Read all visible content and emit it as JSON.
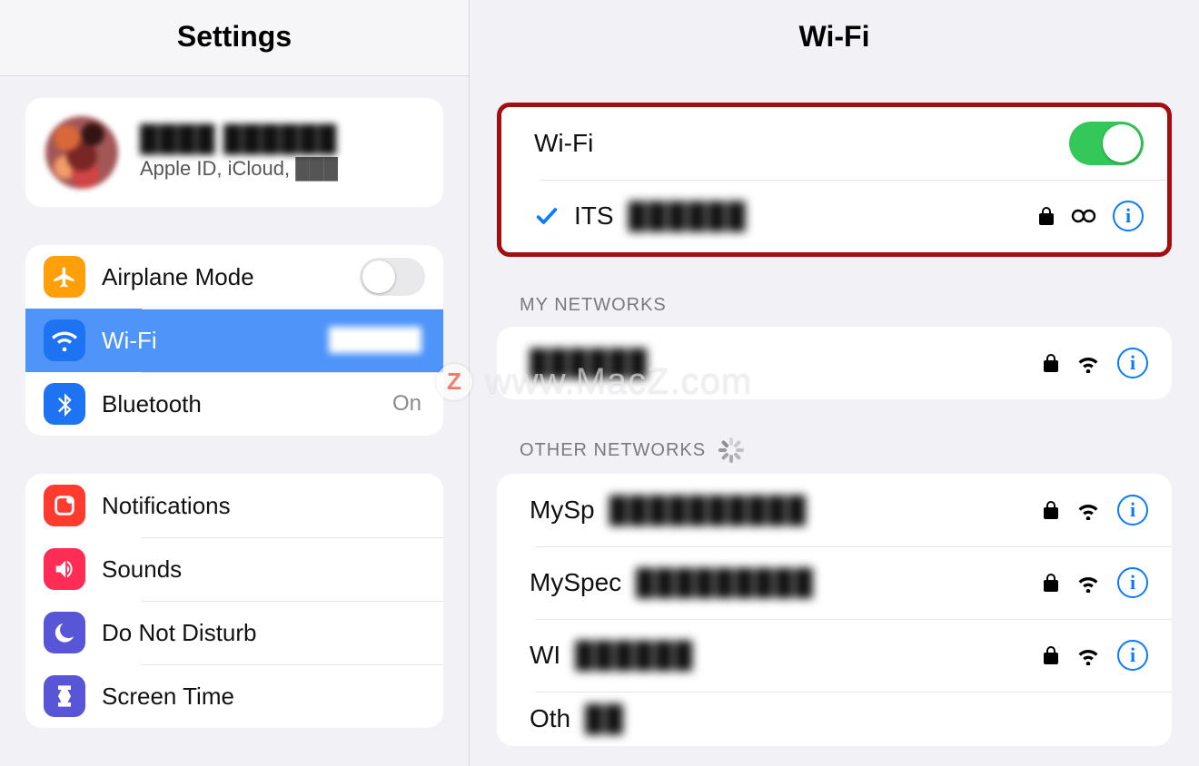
{
  "sidebar": {
    "title": "Settings",
    "account": {
      "name": "████ ██████",
      "sub": "Apple ID, iCloud, ███"
    },
    "group1": {
      "airplane": {
        "label": "Airplane Mode",
        "on": false
      },
      "wifi": {
        "label": "Wi-Fi",
        "value": "██████"
      },
      "bluetooth": {
        "label": "Bluetooth",
        "value": "On"
      }
    },
    "group2": {
      "notifications": {
        "label": "Notifications"
      },
      "sounds": {
        "label": "Sounds"
      },
      "dnd": {
        "label": "Do Not Disturb"
      },
      "screentime": {
        "label": "Screen Time"
      }
    }
  },
  "main": {
    "title": "Wi-Fi",
    "wifi_toggle": {
      "label": "Wi-Fi",
      "on": true
    },
    "connected": {
      "name_prefix": "ITS",
      "name_rest": "██████"
    },
    "my_networks_header": "MY NETWORKS",
    "my_networks": [
      {
        "name": "██████"
      }
    ],
    "other_networks_header": "OTHER NETWORKS",
    "other_networks": [
      {
        "prefix": "MySp",
        "rest": "██████████"
      },
      {
        "prefix": "MySpec",
        "rest": "█████████"
      },
      {
        "prefix": "WI",
        "rest": "██████"
      },
      {
        "prefix": "Oth",
        "rest": "██"
      }
    ]
  },
  "watermark": {
    "badge": "Z",
    "text": "www.MacZ.com"
  }
}
